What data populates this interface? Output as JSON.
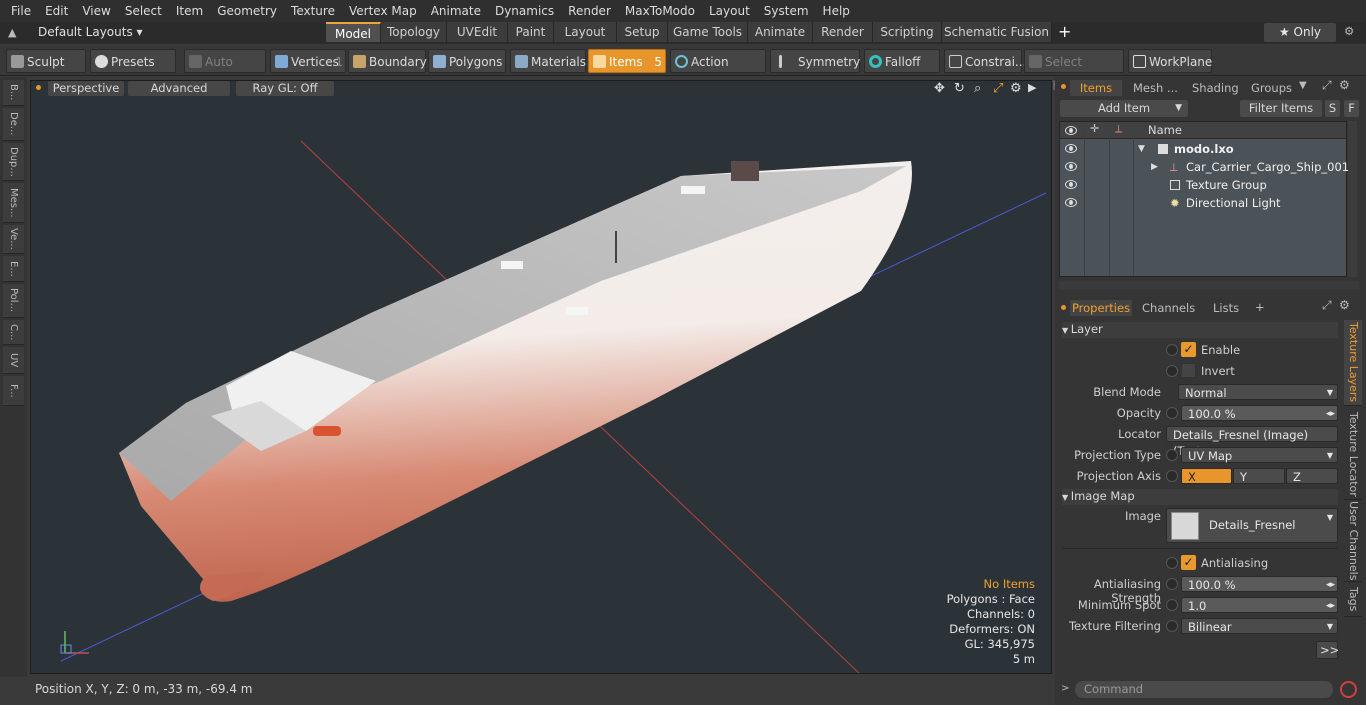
{
  "menu": [
    "File",
    "Edit",
    "View",
    "Select",
    "Item",
    "Geometry",
    "Texture",
    "Vertex Map",
    "Animate",
    "Dynamics",
    "Render",
    "MaxToModo",
    "Layout",
    "System",
    "Help"
  ],
  "layouts": {
    "label": "Default Layouts ▾"
  },
  "layout_tabs": [
    "Model",
    "Topology",
    "UVEdit",
    "Paint",
    "Layout",
    "Setup",
    "Game Tools",
    "Animate",
    "Render",
    "Scripting",
    "Schematic Fusion"
  ],
  "plus": "+",
  "only_label": "★  Only",
  "toolbar": {
    "sculpt": "Sculpt",
    "presets": "Presets",
    "auto_select": "Auto Select",
    "vertices": "Vertices",
    "vertices_count": "1",
    "boundary": "Boundary",
    "polygons": "Polygons",
    "materials": "Materials",
    "items": "Items",
    "items_count": "5",
    "action_center": "Action Center",
    "symmetry": "Symmetry",
    "falloff": "Falloff",
    "constraints": "Constrai...",
    "select_through": "Select Through",
    "workplane": "WorkPlane"
  },
  "left_tabs": [
    "B...",
    "De...",
    "Dup...",
    "Mes...",
    "Ve...",
    "E...",
    "Pol...",
    "C...",
    "UV",
    "F..."
  ],
  "viewport": {
    "perspective": "Perspective",
    "advanced": "Advanced",
    "raygl": "Ray GL: Off"
  },
  "stats": {
    "no_items": "No Items",
    "polygons": "Polygons : Face",
    "channels": "Channels: 0",
    "deformers": "Deformers: ON",
    "gl": "GL: 345,975",
    "scale": "5 m"
  },
  "status": {
    "position": "Position X, Y, Z:   0 m, -33 m, -69.4 m"
  },
  "items_panel": {
    "tabs": [
      "Items",
      "Mesh ...",
      "Shading",
      "Groups"
    ],
    "add_item": "Add Item",
    "filter": "Filter Items",
    "s": "S",
    "f": "F",
    "name_col": "Name",
    "rows": [
      {
        "name": "modo.lxo"
      },
      {
        "name": "Car_Carrier_Cargo_Ship_001"
      },
      {
        "name": "Texture Group"
      },
      {
        "name": "Directional Light"
      }
    ]
  },
  "props_panel": {
    "tabs": [
      "Properties",
      "Channels",
      "Lists"
    ],
    "layer": "Layer",
    "enable": "Enable",
    "invert": "Invert",
    "blend_mode_label": "Blend Mode",
    "blend_mode": "Normal",
    "opacity_label": "Opacity",
    "opacity": "100.0 %",
    "locator_label": "Locator",
    "locator": "Details_Fresnel (Image) (Text...",
    "proj_type_label": "Projection Type",
    "proj_type": "UV Map",
    "proj_axis_label": "Projection Axis",
    "axis_x": "X",
    "axis_y": "Y",
    "axis_z": "Z",
    "image_map": "Image Map",
    "image_label": "Image",
    "image": "Details_Fresnel",
    "antialiasing": "Antialiasing",
    "aa_strength_label": "Antialiasing Strength",
    "aa_strength": "100.0 %",
    "min_spot_label": "Minimum Spot",
    "min_spot": "1.0",
    "tex_filter_label": "Texture Filtering",
    "tex_filter": "Bilinear",
    "more": ">>",
    "side_tabs": [
      "Texture Layers",
      "Texture Locator",
      "User Channels",
      "Tags"
    ]
  },
  "command": {
    "placeholder": "Command"
  }
}
